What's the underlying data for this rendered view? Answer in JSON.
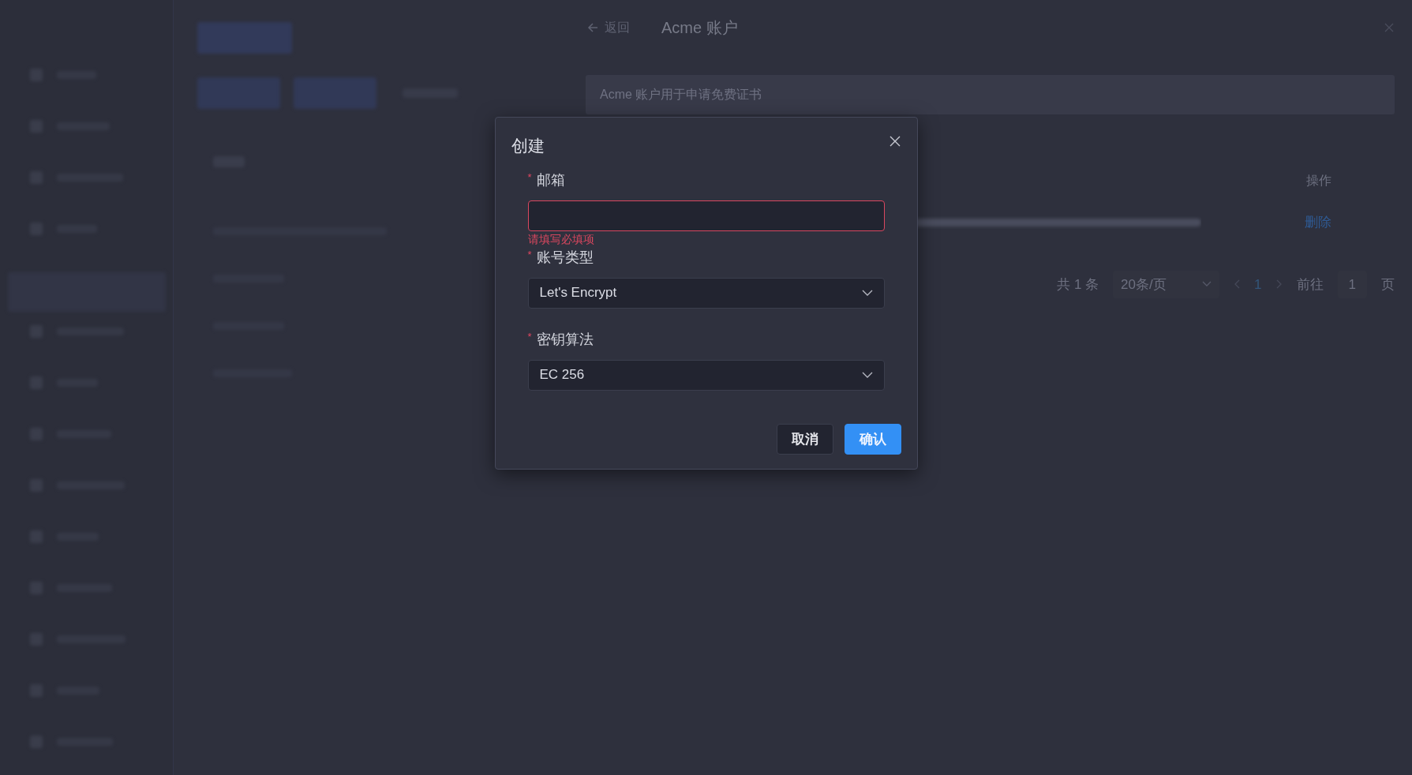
{
  "drawer": {
    "back_label": "返回",
    "title": "Acme 账户",
    "description": "Acme 账户用于申请免费证书",
    "table": {
      "columns": [
        "操作"
      ],
      "rows": [
        {
          "action": "删除"
        }
      ]
    },
    "pagination": {
      "total": "共 1 条",
      "page_size": "20条/页",
      "current_page": "1",
      "goto_label": "前往",
      "goto_value": "1",
      "page_suffix": "页"
    }
  },
  "dialog": {
    "title": "创建",
    "fields": [
      {
        "kind": "input",
        "required_mark": "*",
        "label": "邮箱",
        "invalid": true,
        "error": "请填写必填项"
      },
      {
        "kind": "select",
        "required_mark": "*",
        "label": "账号类型",
        "invalid": false,
        "value": "Let's Encrypt"
      },
      {
        "kind": "select",
        "required_mark": "*",
        "label": "密钥算法",
        "invalid": false,
        "value": "EC 256"
      }
    ],
    "buttons": [
      {
        "kind": "default",
        "label": "取消"
      },
      {
        "kind": "primary",
        "label": "确认"
      }
    ]
  }
}
